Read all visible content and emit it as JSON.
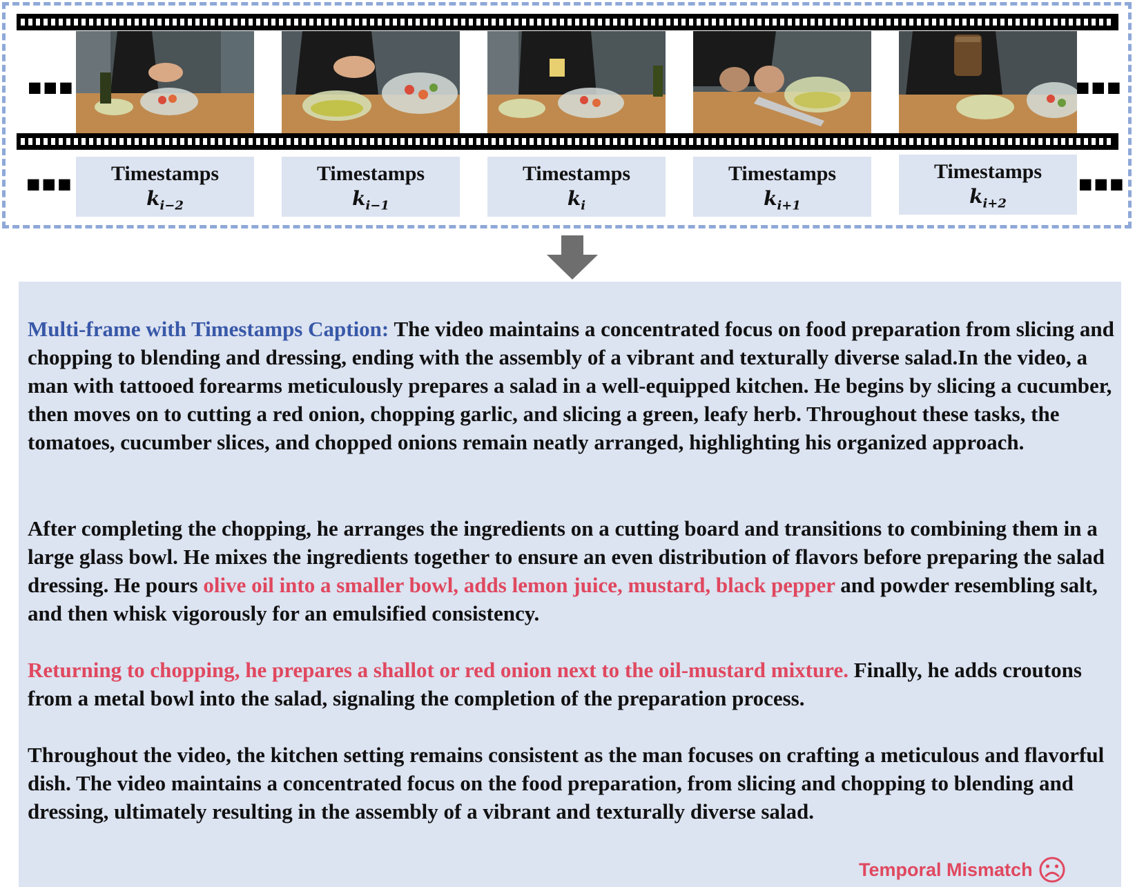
{
  "filmstrip": {
    "ellipsis": "■■■",
    "frames": [
      {
        "id": "frame-1",
        "timestamp_label": "Timestamps",
        "index_base": "k",
        "index_sub": "i−2"
      },
      {
        "id": "frame-2",
        "timestamp_label": "Timestamps",
        "index_base": "k",
        "index_sub": "i−1"
      },
      {
        "id": "frame-3",
        "timestamp_label": "Timestamps",
        "index_base": "k",
        "index_sub": "i"
      },
      {
        "id": "frame-4",
        "timestamp_label": "Timestamps",
        "index_base": "k",
        "index_sub": "i+1"
      },
      {
        "id": "frame-5",
        "timestamp_label": "Timestamps",
        "index_base": "k",
        "index_sub": "i+2"
      }
    ]
  },
  "caption": {
    "heading": "Multi-frame with Timestamps Caption:",
    "p1_text": " The video maintains a concentrated focus on food preparation from slicing and chopping to blending and dressing, ending with the assembly of a vibrant and texturally diverse salad.In the video, a man with tattooed forearms meticulously prepares a salad in a well-equipped kitchen. He begins by slicing a cucumber, then moves on to cutting a red onion, chopping garlic, and slicing a green, leafy herb. Throughout these tasks, the tomatoes, cucumber slices, and chopped onions remain neatly arranged, highlighting his organized approach.",
    "p2_a": "After completing the chopping, he arranges the ingredients on a cutting board and transitions to combining them in a large glass bowl. He mixes the ingredients together to ensure an even distribution of flavors before preparing the salad dressing. He pours ",
    "p2_highlight": "olive oil into a smaller bowl, adds lemon juice, mustard, black pepper",
    "p2_b": " and powder resembling salt, and then whisk vigorously for an emulsified consistency.",
    "p3_highlight": "Returning to chopping, he prepares a shallot or red onion next to the oil-mustard mixture.",
    "p3_b": "  Finally, he adds croutons from a metal bowl into the salad, signaling the completion of the preparation process.",
    "p4_text": "Throughout the video, the kitchen setting remains consistent as the man focuses on crafting a meticulous and flavorful dish. The video maintains a concentrated focus on the food preparation, from slicing and chopping to blending and dressing, ultimately resulting in the assembly of a vibrant and texturally diverse salad."
  },
  "badge": {
    "label": "Temporal Mismatch",
    "icon": "sad-face-icon"
  },
  "colors": {
    "heading": "#3858a8",
    "highlight": "#e0485f",
    "panel": "#dce3f1",
    "dash": "#8fa8d8"
  }
}
